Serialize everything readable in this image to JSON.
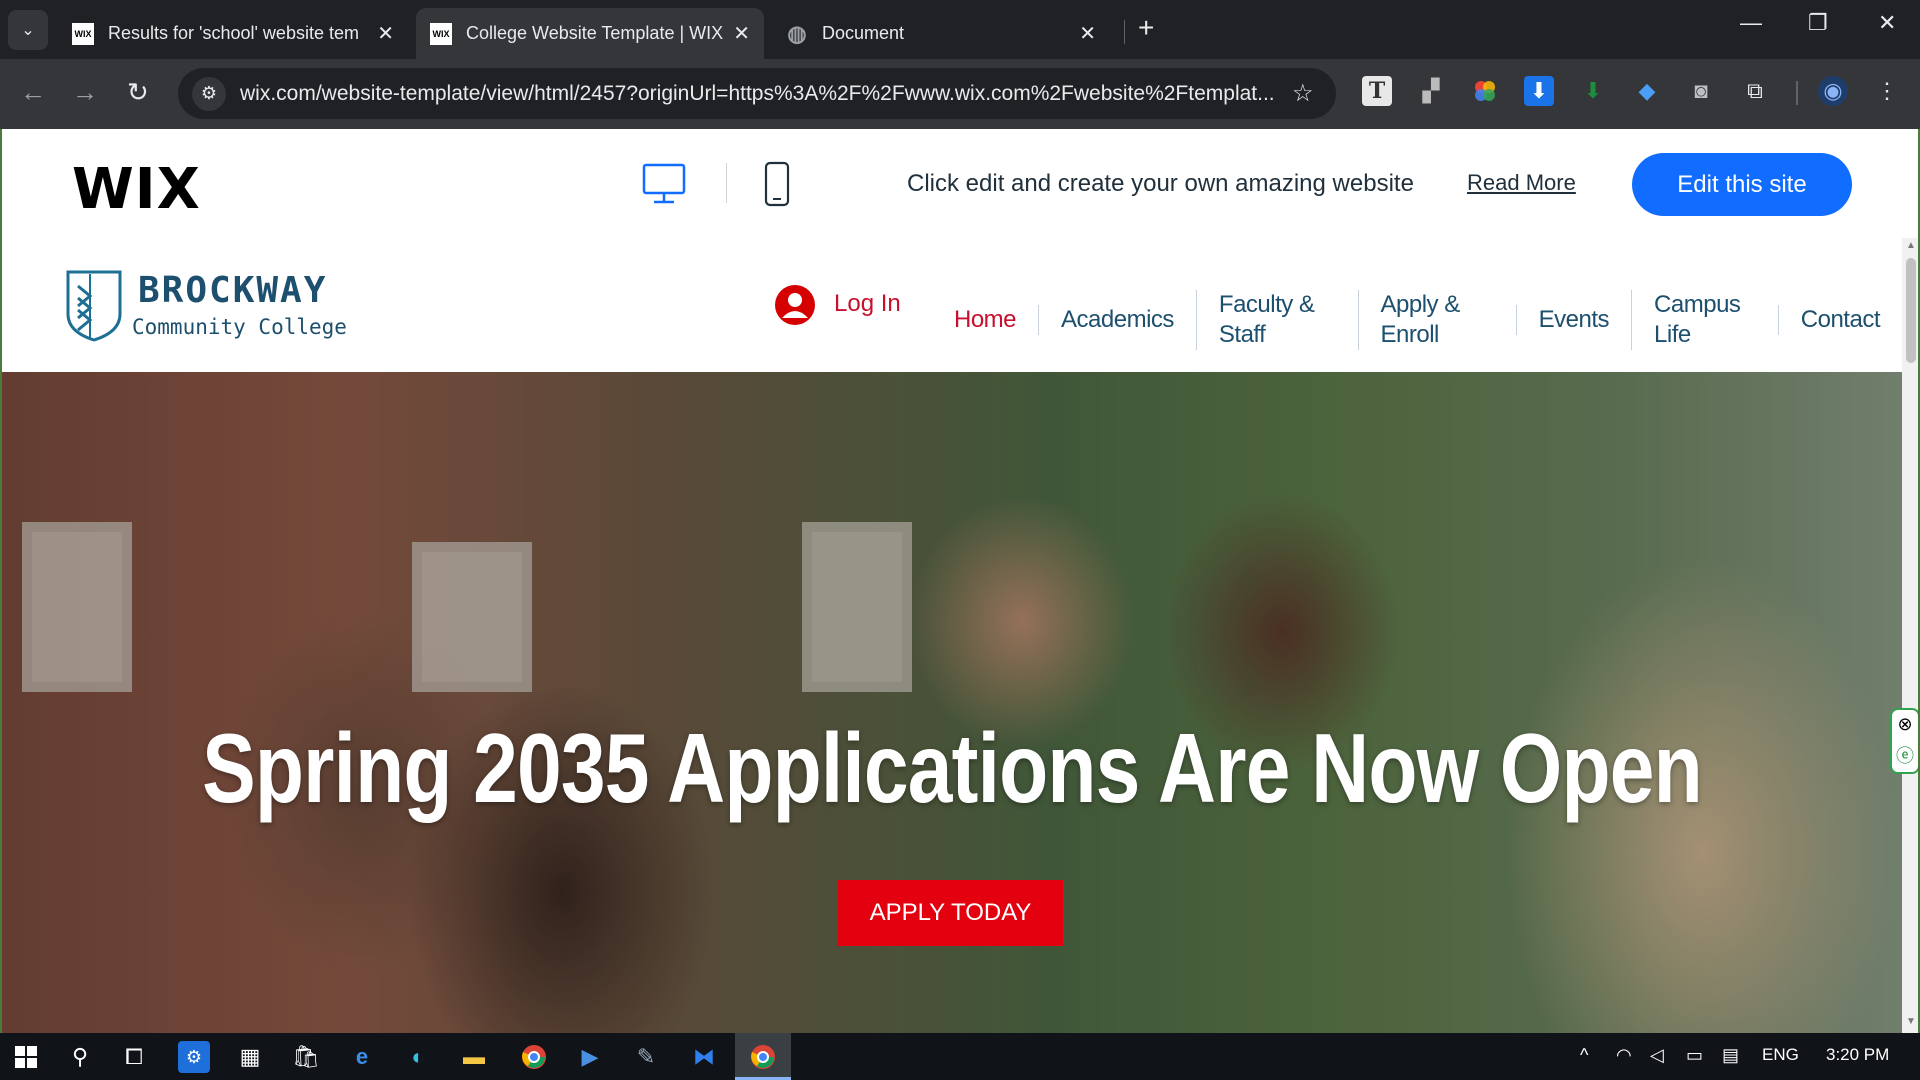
{
  "browser": {
    "tabs": [
      {
        "favicon": "WIX",
        "title": "Results for 'school' website tem",
        "active": false
      },
      {
        "favicon": "WIX",
        "title": "College Website Template | WIX",
        "active": true
      },
      {
        "favicon": "globe-icon",
        "title": "Document",
        "active": false
      }
    ],
    "url": "wix.com/website-template/view/html/2457?originUrl=https%3A%2F%2Fwww.wix.com%2Fwebsite%2Ftemplat..."
  },
  "wix_bar": {
    "logo": "WIX",
    "promo": "Click edit and create your own amazing website",
    "read_more": "Read More",
    "edit_button": "Edit this site"
  },
  "site": {
    "brand": {
      "name": "BROCKWAY",
      "subtitle": "Community College"
    },
    "login": "Log In",
    "nav": [
      "Home",
      "Academics",
      "Faculty & Staff",
      "Apply & Enroll",
      "Events",
      "Campus Life",
      "Contact"
    ],
    "hero": {
      "title": "Spring 2035 Applications Are Now Open",
      "button": "APPLY TODAY"
    }
  },
  "taskbar": {
    "language": "ENG",
    "time": "3:20 PM"
  },
  "colors": {
    "wix_blue": "#116dff",
    "brand_navy": "#1d4f6e",
    "accent_red": "#c8102e",
    "cta_red": "#e3000f"
  }
}
